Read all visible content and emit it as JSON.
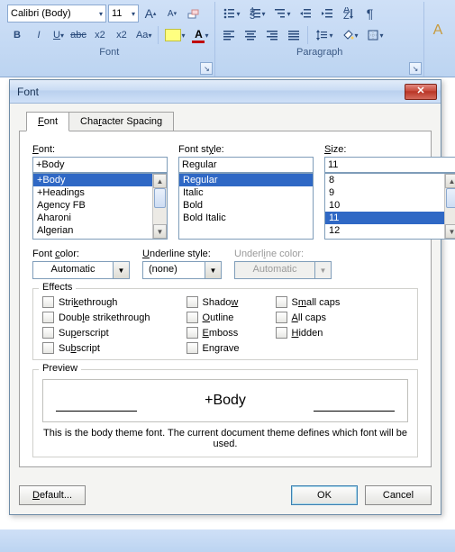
{
  "ribbon": {
    "font_name": "Calibri (Body)",
    "font_size": "11",
    "group_font": "Font",
    "group_paragraph": "Paragraph",
    "bold": "B",
    "italic": "I",
    "underline": "U",
    "strike": "abc",
    "sub": "x",
    "sub2": "2",
    "sup": "x",
    "sup2": "2",
    "changecase": "Aa",
    "grow": "A",
    "shrink": "A",
    "clear": "A",
    "showmarks": "¶"
  },
  "dialog": {
    "title": "Font",
    "tabs": {
      "font": "Font",
      "charspacing": "Character Spacing"
    },
    "labels": {
      "font": "Font:",
      "fontstyle": "Font style:",
      "size": "Size:",
      "fontcolor": "Font color:",
      "underlinestyle": "Underline style:",
      "underlinecolor": "Underline color:"
    },
    "font_value": "+Body",
    "font_list": [
      "+Body",
      "+Headings",
      "Agency FB",
      "Aharoni",
      "Algerian"
    ],
    "fontstyle_value": "Regular",
    "fontstyle_list": [
      "Regular",
      "Italic",
      "Bold",
      "Bold Italic"
    ],
    "size_value": "11",
    "size_list": [
      "8",
      "9",
      "10",
      "11",
      "12"
    ],
    "fontcolor_value": "Automatic",
    "underlinestyle_value": "(none)",
    "underlinecolor_value": "Automatic",
    "effects_legend": "Effects",
    "effects": {
      "strike": "Strikethrough",
      "dstrike": "Double strikethrough",
      "superscript": "Superscript",
      "subscript": "Subscript",
      "shadow": "Shadow",
      "outline": "Outline",
      "emboss": "Emboss",
      "engrave": "Engrave",
      "smallcaps": "Small caps",
      "allcaps": "All caps",
      "hidden": "Hidden"
    },
    "preview_legend": "Preview",
    "preview_text": "+Body",
    "hint": "This is the body theme font. The current document theme defines which font will be used.",
    "buttons": {
      "default": "Default...",
      "ok": "OK",
      "cancel": "Cancel"
    }
  }
}
